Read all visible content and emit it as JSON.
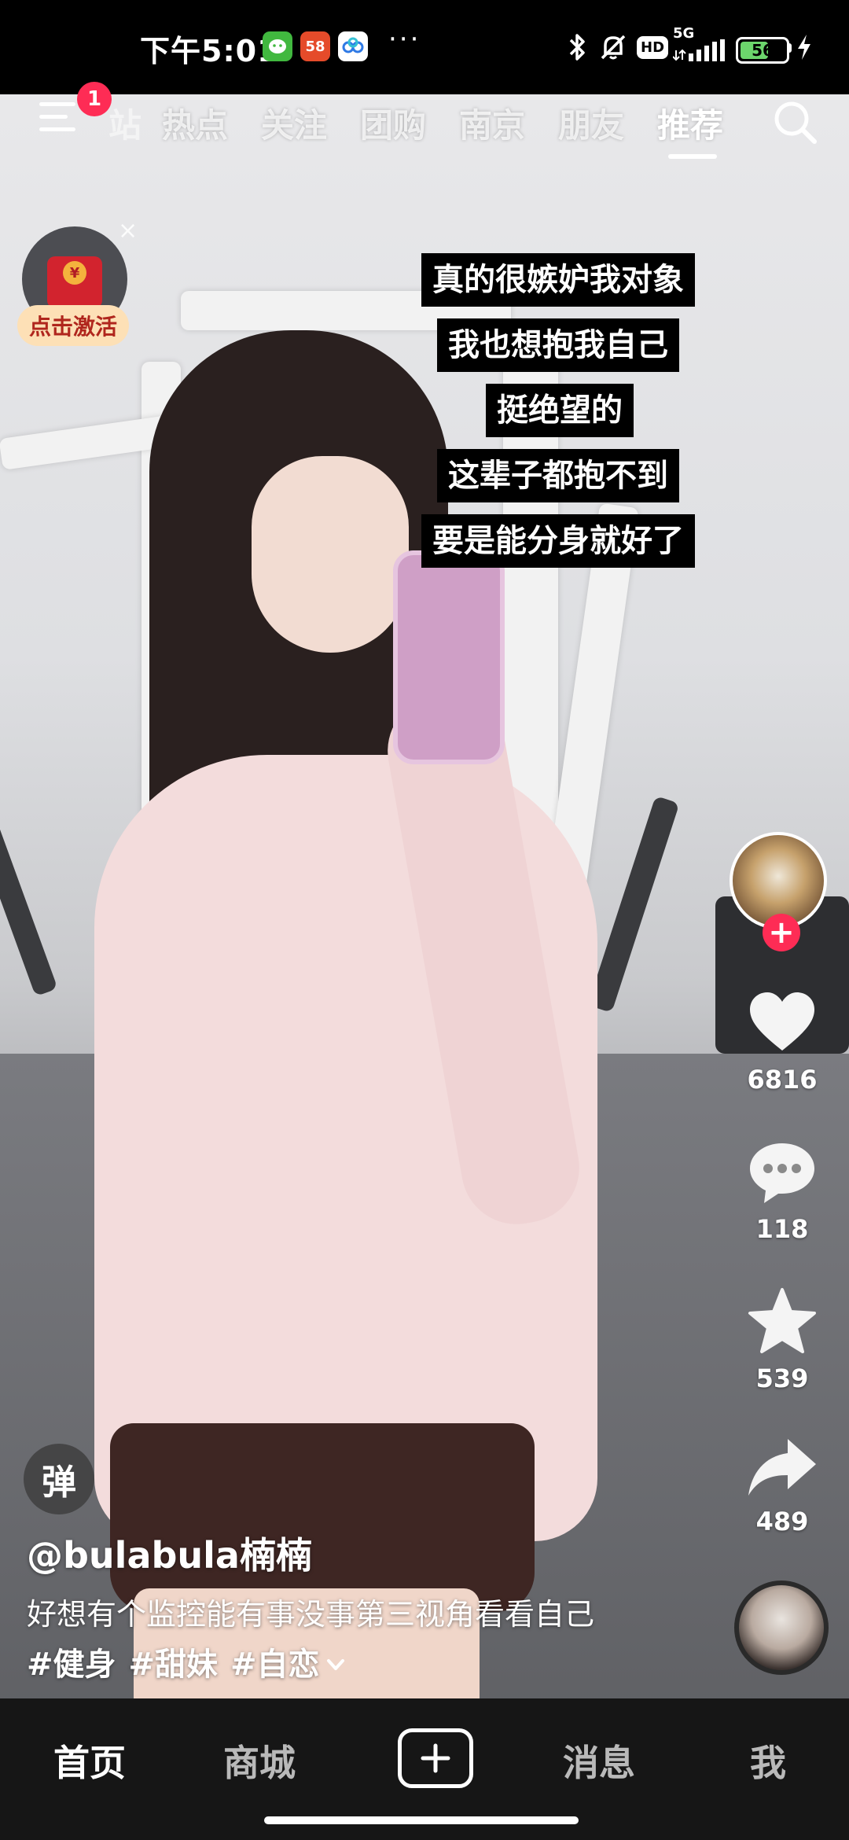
{
  "status_bar": {
    "time": "下午5:01",
    "app_icons": [
      {
        "label": "",
        "color": "#41b83f"
      },
      {
        "label": "58",
        "color": "#e54b2a"
      },
      {
        "label": "",
        "color": "#2f7ae5"
      }
    ],
    "dots": "···",
    "hd_label": "HD",
    "network_label": "5G",
    "battery": "56"
  },
  "top_nav": {
    "notification_count": "1",
    "faded_tab": "站",
    "tabs": [
      "热点",
      "关注",
      "团购",
      "南京",
      "朋友",
      "推荐"
    ],
    "active_tab": "推荐"
  },
  "red_packet": {
    "label": "点击激活",
    "close": "×",
    "coin": "¥"
  },
  "captions": [
    "真的很嫉妒我对象",
    "我也想抱我自己",
    "挺绝望的",
    "这辈子都抱不到",
    "要是能分身就好了"
  ],
  "actions": {
    "likes": "6816",
    "comments": "118",
    "favorites": "539",
    "shares": "489",
    "follow_symbol": "+"
  },
  "video_info": {
    "danmaku": "弹",
    "author": "@bulabula楠楠",
    "description": "好想有个监控能有事没事第三视角看看自己",
    "tags": [
      "#健身",
      "#甜妹",
      "#自恋"
    ]
  },
  "bottom_nav": {
    "home": "首页",
    "mall": "商城",
    "messages": "消息",
    "me": "我"
  },
  "colors": {
    "accent": "#fe2c55",
    "nav_bg": "#161616",
    "caption_bg": "#000000"
  }
}
